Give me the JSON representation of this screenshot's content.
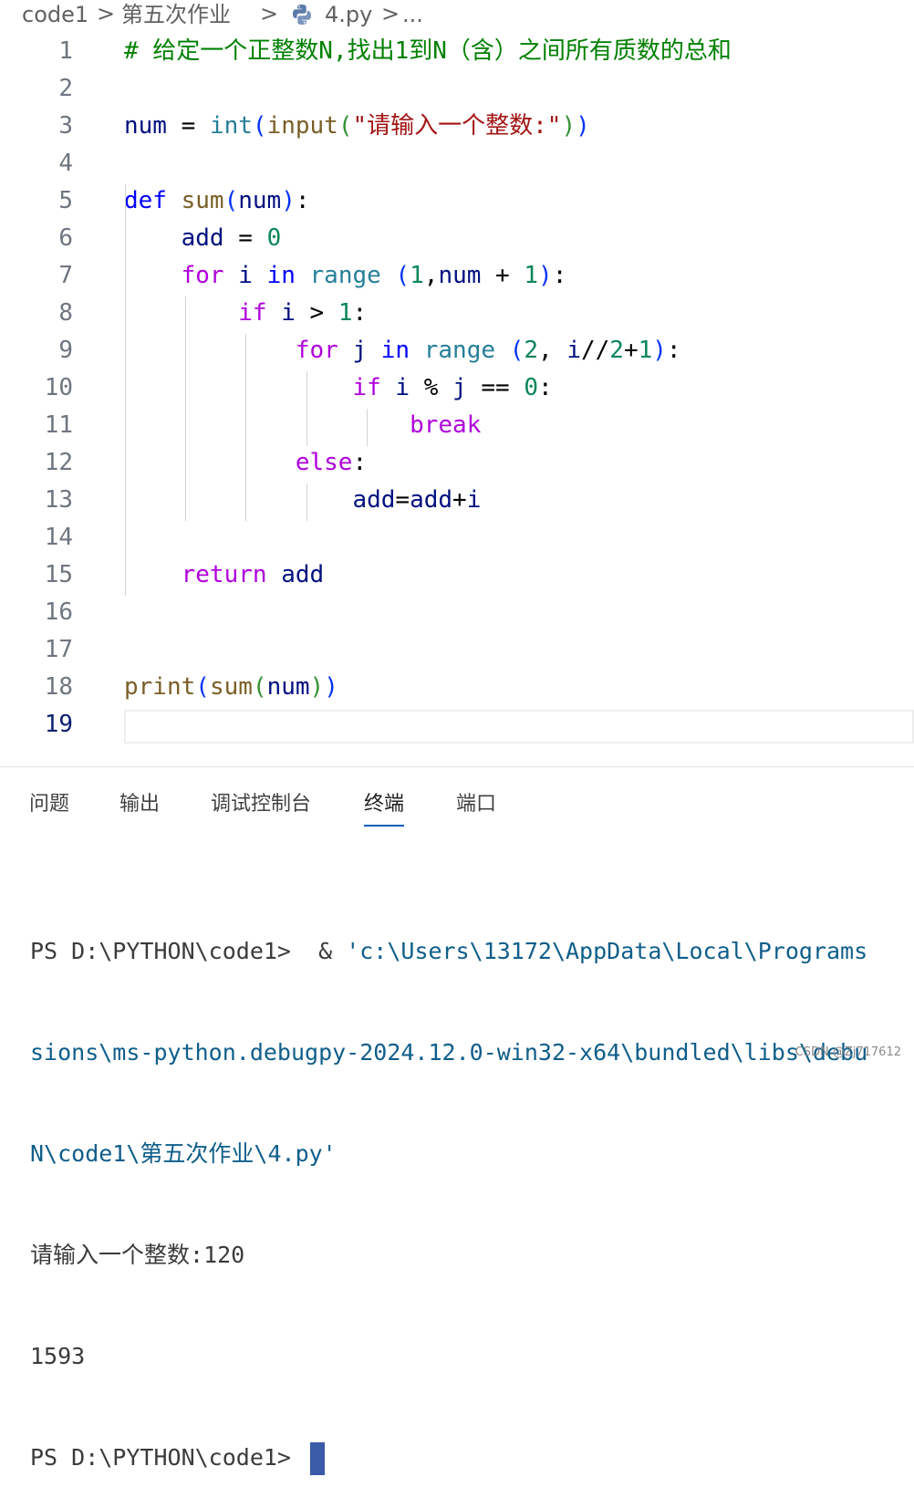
{
  "breadcrumb": {
    "folder": "code1",
    "subfolder": "第五次作业",
    "file": "4.py",
    "more": "...",
    "separator": ">"
  },
  "editor": {
    "language_icon": "python-icon",
    "active_line": 19,
    "line_numbers": [
      "1",
      "2",
      "3",
      "4",
      "5",
      "6",
      "7",
      "8",
      "9",
      "10",
      "11",
      "12",
      "13",
      "14",
      "15",
      "16",
      "17",
      "18",
      "19"
    ],
    "lines": [
      [
        [
          "cm",
          "# 给定一个正整数N,找出1到N（含）之间所有质数的总和"
        ]
      ],
      [],
      [
        [
          "v",
          "num"
        ],
        [
          "op",
          " = "
        ],
        [
          "bi",
          "int"
        ],
        [
          "p1",
          "("
        ],
        [
          "fn",
          "input"
        ],
        [
          "p2",
          "("
        ],
        [
          "str",
          "\"请输入一个整数:\""
        ],
        [
          "p2",
          ")"
        ],
        [
          "p1",
          ")"
        ]
      ],
      [],
      [
        [
          "bl",
          "def"
        ],
        [
          "op",
          " "
        ],
        [
          "fn",
          "sum"
        ],
        [
          "p1",
          "("
        ],
        [
          "v",
          "num"
        ],
        [
          "p1",
          ")"
        ],
        [
          "op",
          ":"
        ]
      ],
      [
        [
          "op",
          "    "
        ],
        [
          "v",
          "add"
        ],
        [
          "op",
          " = "
        ],
        [
          "num",
          "0"
        ]
      ],
      [
        [
          "op",
          "    "
        ],
        [
          "kw",
          "for"
        ],
        [
          "op",
          " "
        ],
        [
          "v",
          "i"
        ],
        [
          "op",
          " "
        ],
        [
          "bl",
          "in"
        ],
        [
          "op",
          " "
        ],
        [
          "bi",
          "range"
        ],
        [
          "op",
          " "
        ],
        [
          "p1",
          "("
        ],
        [
          "num",
          "1"
        ],
        [
          "op",
          ","
        ],
        [
          "v",
          "num"
        ],
        [
          "op",
          " + "
        ],
        [
          "num",
          "1"
        ],
        [
          "p1",
          ")"
        ],
        [
          "op",
          ":"
        ]
      ],
      [
        [
          "op",
          "        "
        ],
        [
          "kw",
          "if"
        ],
        [
          "op",
          " "
        ],
        [
          "v",
          "i"
        ],
        [
          "op",
          " > "
        ],
        [
          "num",
          "1"
        ],
        [
          "op",
          ":"
        ]
      ],
      [
        [
          "op",
          "            "
        ],
        [
          "kw",
          "for"
        ],
        [
          "op",
          " "
        ],
        [
          "v",
          "j"
        ],
        [
          "op",
          " "
        ],
        [
          "bl",
          "in"
        ],
        [
          "op",
          " "
        ],
        [
          "bi",
          "range"
        ],
        [
          "op",
          " "
        ],
        [
          "p1",
          "("
        ],
        [
          "num",
          "2"
        ],
        [
          "op",
          ", "
        ],
        [
          "v",
          "i"
        ],
        [
          "op",
          "//"
        ],
        [
          "num",
          "2"
        ],
        [
          "op",
          "+"
        ],
        [
          "num",
          "1"
        ],
        [
          "p1",
          ")"
        ],
        [
          "op",
          ":"
        ]
      ],
      [
        [
          "op",
          "                "
        ],
        [
          "kw",
          "if"
        ],
        [
          "op",
          " "
        ],
        [
          "v",
          "i"
        ],
        [
          "op",
          " % "
        ],
        [
          "v",
          "j"
        ],
        [
          "op",
          " == "
        ],
        [
          "num",
          "0"
        ],
        [
          "op",
          ":"
        ]
      ],
      [
        [
          "op",
          "                    "
        ],
        [
          "kw",
          "break"
        ]
      ],
      [
        [
          "op",
          "            "
        ],
        [
          "kw",
          "else"
        ],
        [
          "op",
          ":"
        ]
      ],
      [
        [
          "op",
          "                "
        ],
        [
          "v",
          "add"
        ],
        [
          "op",
          "="
        ],
        [
          "v",
          "add"
        ],
        [
          "op",
          "+"
        ],
        [
          "v",
          "i"
        ]
      ],
      [],
      [
        [
          "op",
          "    "
        ],
        [
          "kw",
          "return"
        ],
        [
          "op",
          " "
        ],
        [
          "v",
          "add"
        ]
      ],
      [],
      [],
      [
        [
          "fn",
          "print"
        ],
        [
          "p1",
          "("
        ],
        [
          "fn",
          "sum"
        ],
        [
          "p2",
          "("
        ],
        [
          "v",
          "num"
        ],
        [
          "p2",
          ")"
        ],
        [
          "p1",
          ")"
        ]
      ],
      []
    ]
  },
  "panel": {
    "tabs": [
      "问题",
      "输出",
      "调试控制台",
      "终端",
      "端口"
    ],
    "active_tab": "终端"
  },
  "terminal": {
    "prompt": "PS D:\\PYTHON\\code1> ",
    "line1_cmd": " & ",
    "line1_path": "'c:\\Users\\13172\\AppData\\Local\\Programs",
    "line2": "sions\\ms-python.debugpy-2024.12.0-win32-x64\\bundled\\libs\\debu",
    "line3": "N\\code1\\第五次作业\\4.py'",
    "input_prompt": "请输入一个整数:",
    "input_value": "120",
    "output": "1593"
  },
  "watermark": "CSDN @Zj717612"
}
